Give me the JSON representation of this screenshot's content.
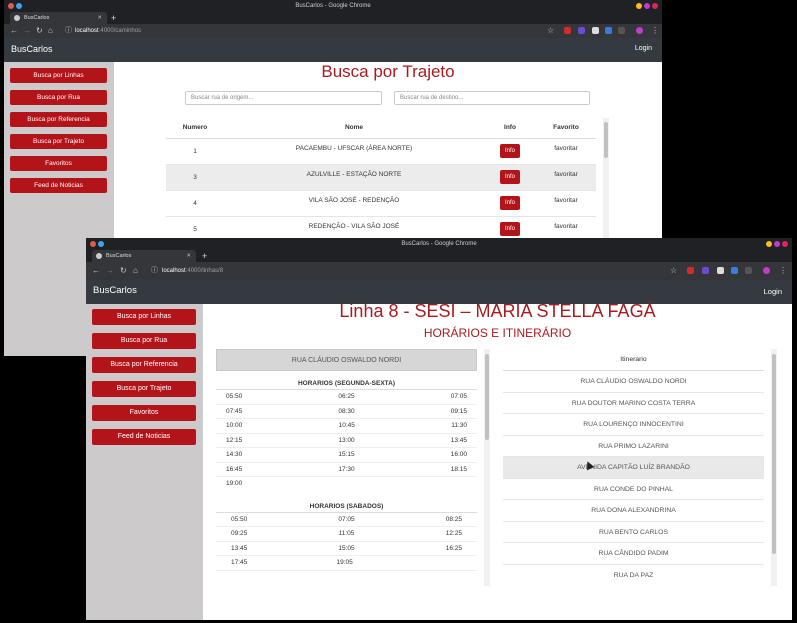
{
  "window1": {
    "title": "BusCarlos - Google Chrome",
    "tab_label": "BusCarlos",
    "url_host": "localhost",
    "url_path": ":4000/caminhos",
    "brand": "BusCarlos",
    "login": "Login",
    "sidebar": [
      "Busca por Linhas",
      "Busca por Rua",
      "Busca por Referencia",
      "Busca por Trajeto",
      "Favoritos",
      "Feed de Noticias"
    ],
    "page_title": "Busca por Trajeto",
    "origin_placeholder": "Buscar rua de origem...",
    "dest_placeholder": "Buscar rua de destino...",
    "table_headers": [
      "Numero",
      "Nome",
      "Info",
      "Favorito"
    ],
    "rows": [
      {
        "num": "1",
        "name": "PACAEMBU - UFSCAR (ÁREA NORTE)",
        "info": "Info",
        "fav": "favoritar"
      },
      {
        "num": "3",
        "name": "AZULVILLE - ESTAÇÃO NORTE",
        "info": "Info",
        "fav": "favoritar"
      },
      {
        "num": "4",
        "name": "VILA SÃO JOSÉ - REDENÇÃO",
        "info": "Info",
        "fav": "favoritar"
      },
      {
        "num": "5",
        "name": "REDENÇÃO - VILA SÃO JOSÉ",
        "info": "Info",
        "fav": "favoritar"
      }
    ]
  },
  "window2": {
    "title": "BusCarlos - Google Chrome",
    "tab_label": "BusCarlos",
    "url_host": "localhost",
    "url_path": ":4000/linhas/8",
    "brand": "BusCarlos",
    "login": "Login",
    "sidebar": [
      "Busca por Linhas",
      "Busca por Rua",
      "Busca por Referencia",
      "Busca por Trajeto",
      "Favoritos",
      "Feed de Noticias"
    ],
    "line_title": "Linha 8 - SESI – MARIA STELLA FAGÁ",
    "subtitle": "HORÁRIOS E ITINERÁRIO",
    "stop_name": "RUA CLÁUDIO OSWALDO NORDI",
    "weekday_title": "HORARIOS (SEGUNDA-SEXTA)",
    "weekday_times": [
      [
        "05:50",
        "06:25",
        "07:05"
      ],
      [
        "07:45",
        "08:30",
        "09:15"
      ],
      [
        "10:00",
        "10:45",
        "11:30"
      ],
      [
        "12:15",
        "13:00",
        "13:45"
      ],
      [
        "14:30",
        "15:15",
        "16:00"
      ],
      [
        "16:45",
        "17:30",
        "18:15"
      ],
      [
        "19:00",
        "",
        ""
      ]
    ],
    "saturday_title": "HORARIOS (SABADOS)",
    "saturday_times": [
      [
        "05:50",
        "07:05",
        "08:25"
      ],
      [
        "09:25",
        "11:05",
        "12:25"
      ],
      [
        "13:45",
        "15:05",
        "16:25"
      ],
      [
        "17:45",
        "19:05",
        ""
      ]
    ],
    "itinerary_header": "Itinerario",
    "itinerary": [
      "RUA CLÁUDIO OSWALDO NORDI",
      "RUA DOUTOR MARINO COSTA TERRA",
      "RUA LOURENÇO INNOCENTINI",
      "RUA PRIMO LAZARINI",
      "AVENIDA CAPITÃO LUÍZ BRANDÃO",
      "RUA CONDE DO PINHAL",
      "RUA DONA ALEXANDRINA",
      "RUA BENTO CARLOS",
      "RUA CÂNDIDO PADIM",
      "RUA DA PAZ"
    ]
  },
  "colors": {
    "accent": "#b3141a",
    "title_red": "#a81b1f",
    "appbar": "#343a40",
    "sidebar": "#cccaca",
    "chrome_dark": "#202124"
  }
}
